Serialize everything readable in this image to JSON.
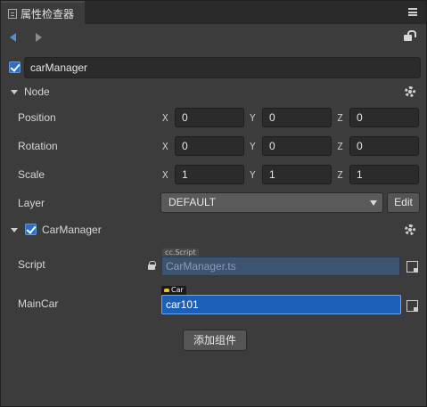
{
  "tab": {
    "title": "属性检查器"
  },
  "node": {
    "enabled": true,
    "name": "carManager"
  },
  "node_section": {
    "title": "Node"
  },
  "transform": {
    "position": {
      "label": "Position",
      "x": "0",
      "y": "0",
      "z": "0"
    },
    "rotation": {
      "label": "Rotation",
      "x": "0",
      "y": "0",
      "z": "0"
    },
    "scale": {
      "label": "Scale",
      "x": "1",
      "y": "1",
      "z": "1"
    },
    "axis_x": "X",
    "axis_y": "Y",
    "axis_z": "Z"
  },
  "layer": {
    "label": "Layer",
    "value": "DEFAULT",
    "edit_label": "Edit"
  },
  "component": {
    "enabled": true,
    "title": "CarManager",
    "script": {
      "label": "Script",
      "tag": "cc.Script",
      "value": "CarManager.ts"
    },
    "main_car": {
      "label": "MainCar",
      "tag": "Car",
      "value": "car101"
    }
  },
  "add_component": {
    "label": "添加组件"
  },
  "colors": {
    "accent": "#2b6fc9",
    "selected_field": "#1c5fb8",
    "panel": "#3c3c3c"
  },
  "icons": [
    "menu-icon",
    "nav-back-icon",
    "nav-forward-icon",
    "unlock-icon",
    "gear-icon",
    "lock-icon",
    "asset-picker-icon"
  ]
}
